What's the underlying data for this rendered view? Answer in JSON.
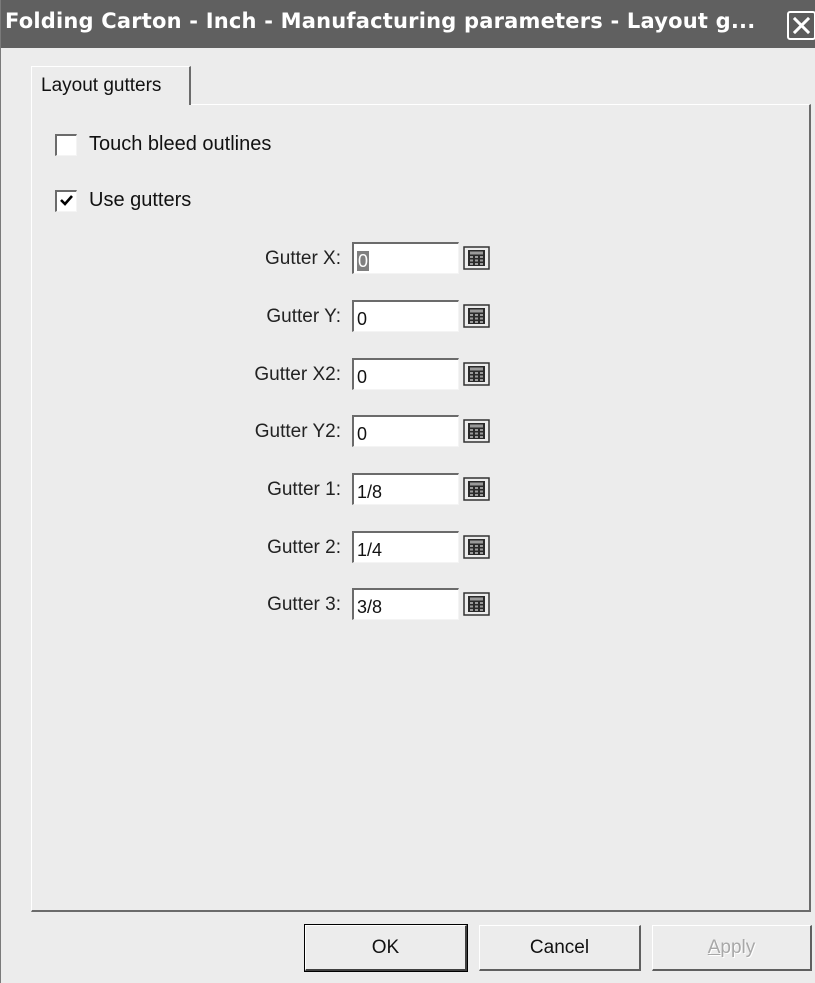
{
  "window": {
    "title": "Folding Carton - Inch - Manufacturing parameters - Layout g...",
    "close_icon": "close-icon"
  },
  "tabs": [
    {
      "label": "Layout gutters",
      "active": true
    }
  ],
  "options": {
    "touch_bleed": {
      "label": "Touch bleed outlines",
      "checked": false
    },
    "use_gutters": {
      "label": "Use gutters",
      "checked": true
    }
  },
  "fields": [
    {
      "label": "Gutter X:",
      "value": "0",
      "selected": true
    },
    {
      "label": "Gutter Y:",
      "value": "0"
    },
    {
      "label": "Gutter X2:",
      "value": "0"
    },
    {
      "label": "Gutter Y2:",
      "value": "0"
    },
    {
      "label": "Gutter 1:",
      "value": "1/8"
    },
    {
      "label": "Gutter 2:",
      "value": "1/4"
    },
    {
      "label": "Gutter 3:",
      "value": "3/8"
    }
  ],
  "buttons": {
    "ok": "OK",
    "cancel": "Cancel",
    "apply": "Apply",
    "apply_enabled": false
  },
  "colors": {
    "title_bar": "#606060",
    "dialog_background": "#ececec"
  }
}
